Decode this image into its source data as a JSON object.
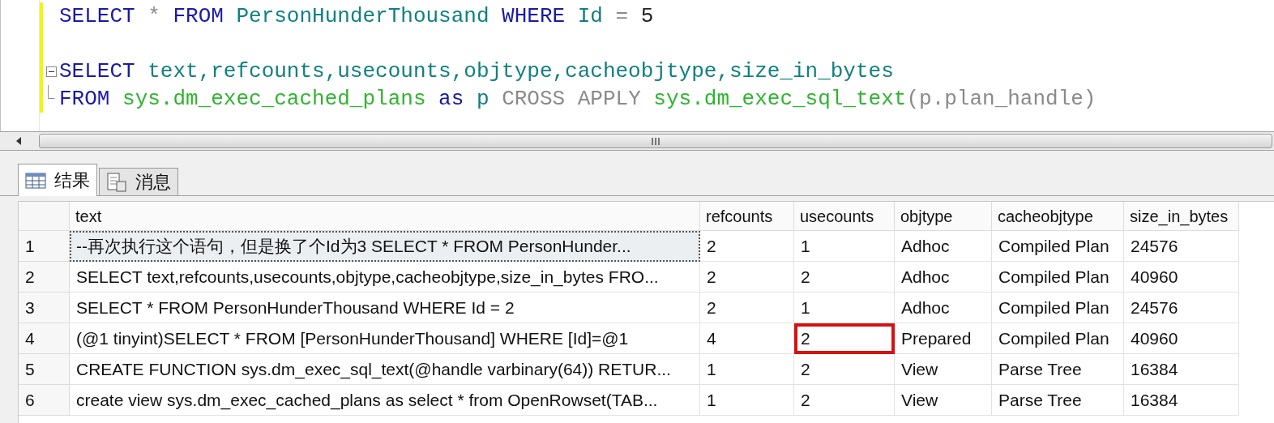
{
  "editor": {
    "lines": [
      {
        "collapsible": false,
        "tokens": [
          {
            "kind": "keyword",
            "text": "SELECT"
          },
          {
            "kind": "operator",
            "text": "*"
          },
          {
            "kind": "keyword",
            "text": "FROM"
          },
          {
            "kind": "identifier",
            "text": "PersonHunderThousand"
          },
          {
            "kind": "keyword",
            "text": "WHERE"
          },
          {
            "kind": "identifier",
            "text": "Id"
          },
          {
            "kind": "operator",
            "text": "="
          },
          {
            "kind": "plain",
            "text": "5"
          }
        ]
      },
      {
        "collapsible": false
      },
      {
        "collapsible": true,
        "tokens": [
          {
            "kind": "keyword",
            "text": "SELECT"
          },
          {
            "kind": "identifier",
            "text": "text,refcounts,usecounts,objtype,cacheobjtype,size_in_bytes"
          }
        ]
      },
      {
        "collapsible": false,
        "tokens": [
          {
            "kind": "keyword",
            "text": "FROM"
          },
          {
            "kind": "system",
            "text": "sys.dm_exec_cached_plans"
          },
          {
            "kind": "keyword",
            "text": "as"
          },
          {
            "kind": "identifier",
            "text": "p"
          },
          {
            "kind": "operator",
            "text": "CROSS APPLY"
          },
          {
            "kind": "system",
            "text": "sys.dm_exec_sql_text"
          },
          {
            "kind": "operator",
            "text": "(p.plan_handle)"
          }
        ]
      }
    ]
  },
  "tabs": [
    {
      "label": "结果",
      "selected": true
    },
    {
      "label": "消息",
      "selected": false
    }
  ],
  "table": {
    "columns": [
      "text",
      "refcounts",
      "usecounts",
      "objtype",
      "cacheobjtype",
      "size_in_bytes"
    ],
    "rows": [
      {
        "number": "1",
        "selected": true,
        "cells": [
          "--再次执行这个语句，但是换了个Id为3  SELECT * FROM PersonHunder...",
          "2",
          "1",
          "Adhoc",
          "Compiled Plan",
          "24576"
        ]
      },
      {
        "number": "2",
        "selected": false,
        "cells": [
          "SELECT text,refcounts,usecounts,objtype,cacheobjtype,size_in_bytes  FRO...",
          "2",
          "2",
          "Adhoc",
          "Compiled Plan",
          "40960"
        ]
      },
      {
        "number": "3",
        "selected": false,
        "cells": [
          "SELECT * FROM PersonHunderThousand WHERE Id = 2",
          "2",
          "1",
          "Adhoc",
          "Compiled Plan",
          "24576"
        ]
      },
      {
        "number": "4",
        "selected": false,
        "cells": [
          "(@1 tinyint)SELECT * FROM [PersonHunderThousand] WHERE [Id]=@1",
          "4",
          {
            "text": "2",
            "boxed": true
          },
          "Prepared",
          "Compiled Plan",
          "40960"
        ]
      },
      {
        "number": "5",
        "selected": false,
        "cells": [
          "CREATE FUNCTION sys.dm_exec_sql_text(@handle varbinary(64))  RETUR...",
          "1",
          "2",
          "View",
          "Parse Tree",
          "16384"
        ]
      },
      {
        "number": "6",
        "selected": false,
        "cells": [
          "create view sys.dm_exec_cached_plans as select * from OpenRowset(TAB...",
          "1",
          "2",
          "View",
          "Parse Tree",
          "16384"
        ]
      }
    ]
  }
}
